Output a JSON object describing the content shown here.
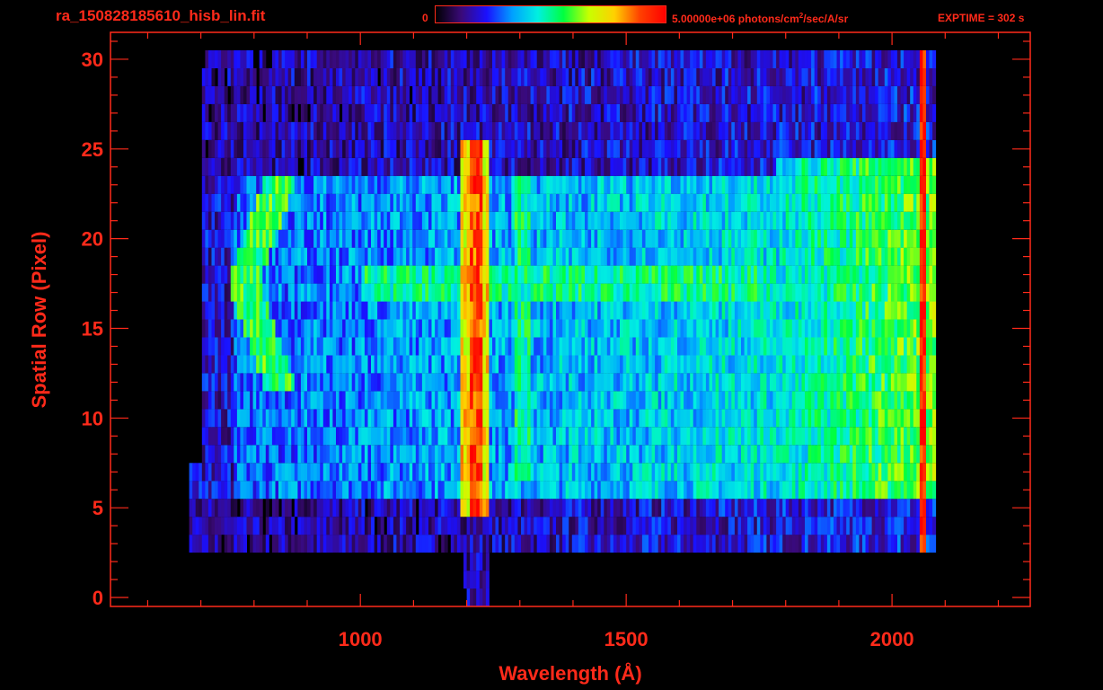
{
  "header": {
    "filename": "ra_150828185610_hisb_lin.fit",
    "colorbar_min_label": "0",
    "colorbar_max_label_pre": "5.00000e+06 photons/cm",
    "colorbar_max_label_sup": "2",
    "colorbar_max_label_post": "/sec/A/sr",
    "exptime_label": "EXPTIME = 302 s"
  },
  "colors": {
    "axis": "#ff2a1a",
    "background": "#000000",
    "colormap": [
      "#000000",
      "#3a0a78",
      "#1a10ff",
      "#00a0ff",
      "#00f0e0",
      "#00ff40",
      "#c8ff00",
      "#ffd000",
      "#ff4000",
      "#ff0000"
    ]
  },
  "chart_data": {
    "type": "heatmap",
    "title": "ra_150828185610_hisb_lin.fit",
    "xlabel": "Wavelength (Å)",
    "ylabel": "Spatial Row (Pixel)",
    "xlim": [
      530,
      2260
    ],
    "ylim": [
      -0.5,
      31.5
    ],
    "x_ticks": [
      1000,
      1500,
      2000
    ],
    "y_ticks": [
      0,
      5,
      10,
      15,
      20,
      25,
      30
    ],
    "colorbar_range": [
      0,
      5000000
    ],
    "colorbar_units": "photons/cm^2/sec/A/sr",
    "exptime_s": 302,
    "features": [
      {
        "name": "Lyman-alpha",
        "wavelength": 1216,
        "rows": [
          5,
          25
        ],
        "level": 0.9
      },
      {
        "name": "OI",
        "wavelength": 1304,
        "rows": [
          7,
          23
        ],
        "level": 0.5
      },
      {
        "name": "spectrum trace",
        "row": 17.5,
        "wavelength_range": [
          1000,
          1780
        ],
        "level": 0.5
      },
      {
        "name": "geocoronal arc",
        "wavelength_range": [
          780,
          920
        ],
        "rows": [
          12,
          23
        ],
        "level": 0.55
      },
      {
        "name": "long-wavelength continuum",
        "wavelength_range": [
          1780,
          2060
        ],
        "rows": [
          6,
          24
        ],
        "level": 0.6
      },
      {
        "name": "detector edge",
        "wavelength": 2060,
        "rows": [
          2,
          30
        ],
        "level": 0.95
      }
    ],
    "grid": false
  }
}
